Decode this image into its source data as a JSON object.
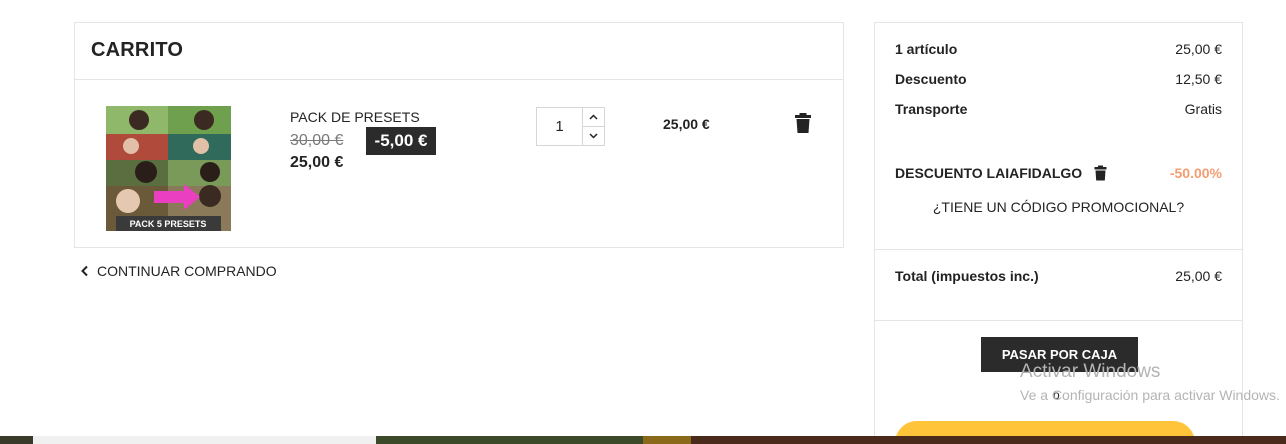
{
  "cart": {
    "title": "CARRITO",
    "item": {
      "name": "PACK DE PRESETS",
      "old_price": "30,00 €",
      "discount": "-5,00 €",
      "new_price": "25,00 €",
      "quantity": "1",
      "line_total": "25,00 €",
      "image_caption": "PACK 5 PRESETS"
    },
    "continue_label": "CONTINUAR COMPRANDO"
  },
  "summary": {
    "articles_label": "1 artículo",
    "articles_value": "25,00 €",
    "discount_label": "Descuento",
    "discount_value": "12,50 €",
    "shipping_label": "Transporte",
    "shipping_value": "Gratis",
    "promo_name": "DESCUENTO LAIAFIDALGO",
    "promo_value": "-50.00%",
    "promo_link": "¿TIENE UN CÓDIGO PROMOCIONAL?",
    "total_label": "Total (impuestos inc.)",
    "total_value": "25,00 €",
    "checkout_label": "PASAR POR CAJA",
    "or_label": "o"
  },
  "watermark": {
    "title": "Activar Windows",
    "subtitle": "Ve a Configuración para activar Windows."
  },
  "colors": {
    "dark_button": "#2b2b2b",
    "promo_accent": "#f39d72",
    "paypal_yellow": "#ffc439",
    "border": "#e5e5e5"
  }
}
